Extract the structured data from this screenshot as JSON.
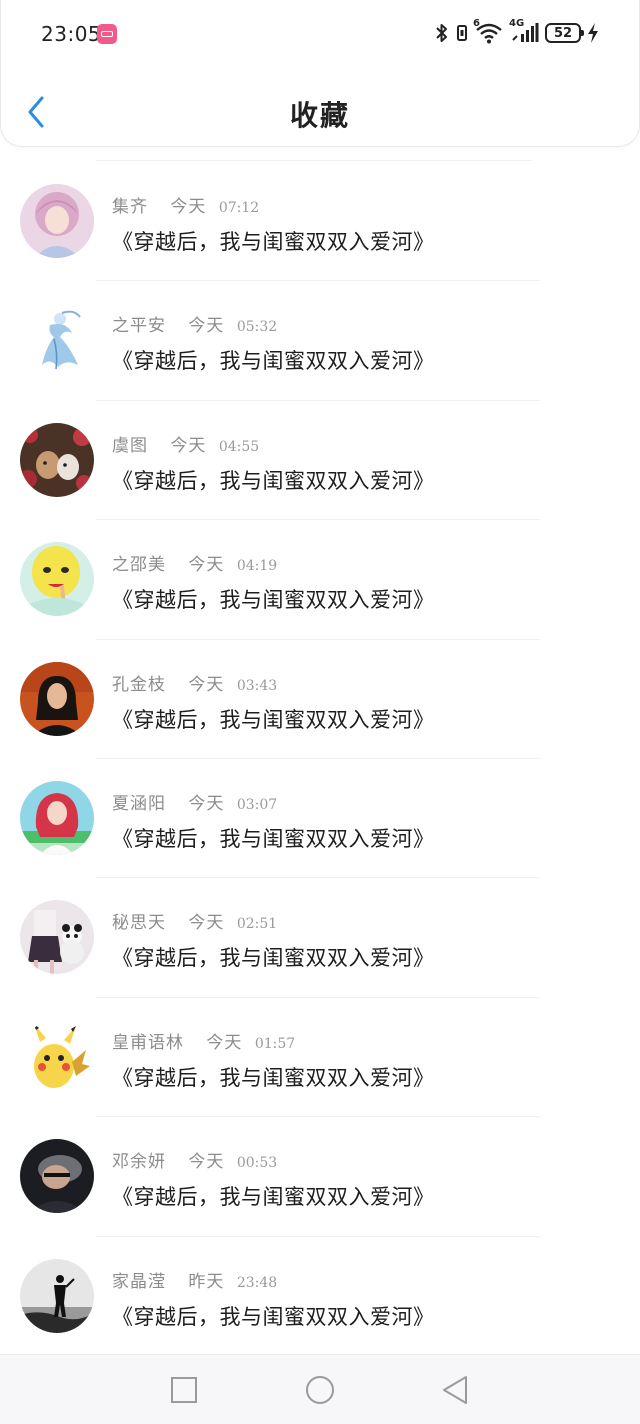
{
  "status_bar": {
    "time": "23:05",
    "network_label": "4G",
    "sim_index": "6",
    "battery": "52"
  },
  "header": {
    "title": "收藏"
  },
  "favorites": [
    {
      "name": "集齐",
      "day": "今天",
      "time": "07:12",
      "text": "《穿越后，我与闺蜜双双入爱河》",
      "avatar": "anime-girl-pink"
    },
    {
      "name": "之平安",
      "day": "今天",
      "time": "05:32",
      "text": "《穿越后，我与闺蜜双双入爱河》",
      "avatar": "blue-fairy"
    },
    {
      "name": "虞图",
      "day": "今天",
      "time": "04:55",
      "text": "《穿越后，我与闺蜜双双入爱河》",
      "avatar": "deer-roses"
    },
    {
      "name": "之邵美",
      "day": "今天",
      "time": "04:19",
      "text": "《穿越后，我与闺蜜双双入爱河》",
      "avatar": "yellow-face"
    },
    {
      "name": "孔金枝",
      "day": "今天",
      "time": "03:43",
      "text": "《穿越后，我与闺蜜双双入爱河》",
      "avatar": "dark-hair-girl"
    },
    {
      "name": "夏涵阳",
      "day": "今天",
      "time": "03:07",
      "text": "《穿越后，我与闺蜜双双入爱河》",
      "avatar": "red-hair-girl"
    },
    {
      "name": "秘思天",
      "day": "今天",
      "time": "02:51",
      "text": "《穿越后，我与闺蜜双双入爱河》",
      "avatar": "panda-girl"
    },
    {
      "name": "皇甫语林",
      "day": "今天",
      "time": "01:57",
      "text": "《穿越后，我与闺蜜双双入爱河》",
      "avatar": "pikachu"
    },
    {
      "name": "邓余妍",
      "day": "今天",
      "time": "00:53",
      "text": "《穿越后，我与闺蜜双双入爱河》",
      "avatar": "dark-portrait"
    },
    {
      "name": "家晶滢",
      "day": "昨天",
      "time": "23:48",
      "text": "《穿越后，我与闺蜜双双入爱河》",
      "avatar": "silhouette-sea"
    }
  ],
  "colors": {
    "accent": "#2a8de0",
    "title_text": "#222222",
    "meta_text": "#8c8c8c",
    "message_text": "#1e1e1e",
    "app_icon": "#f25a8a"
  }
}
